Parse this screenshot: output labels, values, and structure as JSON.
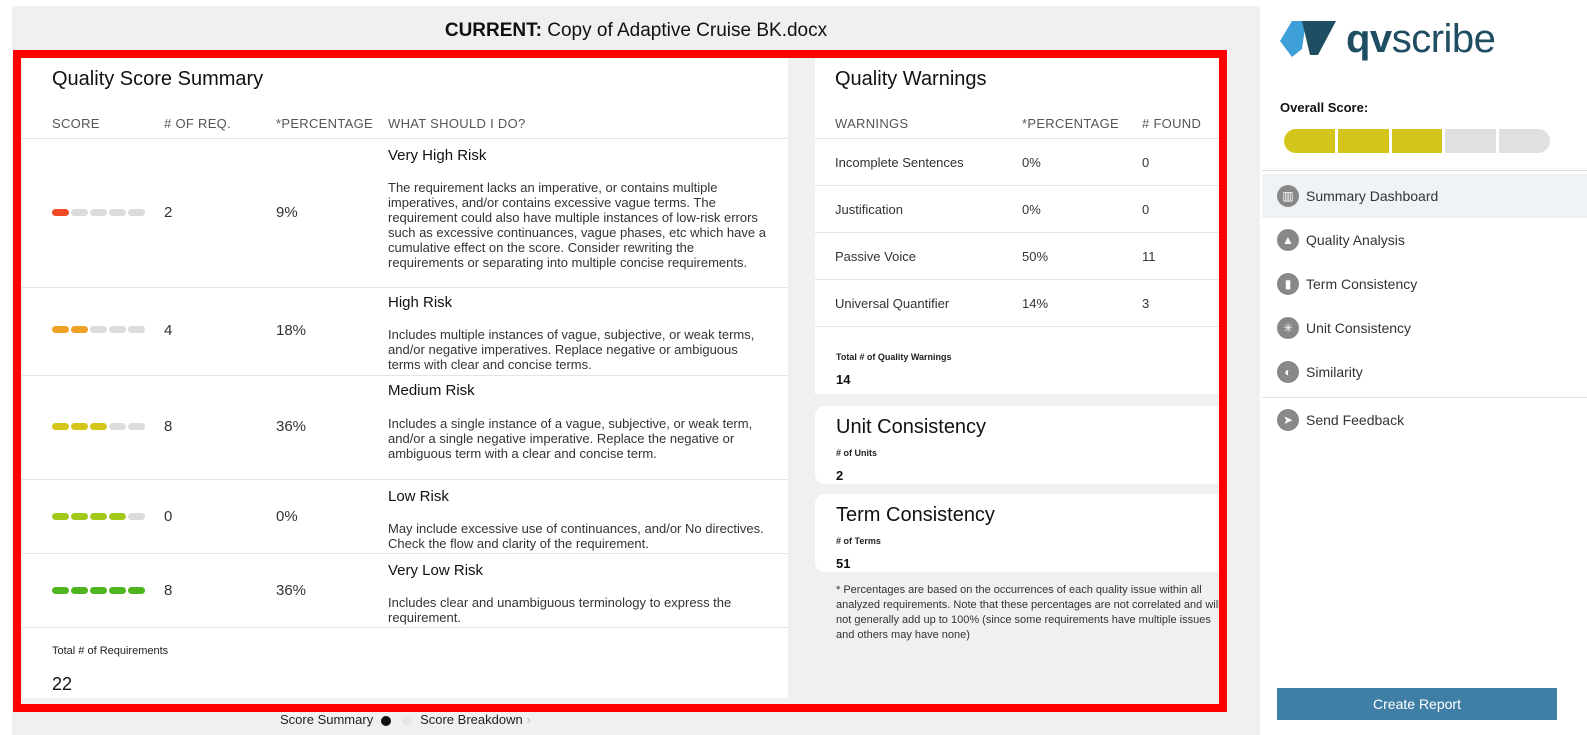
{
  "header": {
    "current_label": "CURRENT:",
    "document_name": "Copy of Adaptive Cruise BK.docx"
  },
  "summary": {
    "title": "Quality Score Summary",
    "columns": {
      "score": "SCORE",
      "num_req": "# OF REQ.",
      "percentage": "*PERCENTAGE",
      "what_to_do": "WHAT SHOULD I DO?"
    },
    "rows": [
      {
        "level": 1,
        "color": "#f04a24",
        "count": "2",
        "percentage": "9%",
        "title": "Very High Risk",
        "description": "The requirement lacks an imperative, or contains multiple imperatives, and/or contains excessive vague terms. The requirement could also have multiple instances of low-risk errors such as excessive continuances, vague phases, etc which have a cumulative effect on the score. Consider rewriting the requirements or separating into multiple concise requirements."
      },
      {
        "level": 2,
        "color": "#f0a025",
        "count": "4",
        "percentage": "18%",
        "title": "High Risk",
        "description": "Includes multiple instances of vague, subjective, or weak terms, and/or negative imperatives. Replace negative or ambiguous terms with clear and concise terms."
      },
      {
        "level": 3,
        "color": "#d4c51a",
        "count": "8",
        "percentage": "36%",
        "title": "Medium Risk",
        "description": "Includes a single instance of a vague, subjective, or weak term, and/or a single negative imperative. Replace the negative or ambiguous term with a clear and concise term."
      },
      {
        "level": 4,
        "color": "#a3c81c",
        "count": "0",
        "percentage": "0%",
        "title": "Low Risk",
        "description": "May include excessive use of continuances, and/or No directives. Check the flow and clarity of the requirement."
      },
      {
        "level": 5,
        "color": "#4fb51f",
        "count": "8",
        "percentage": "36%",
        "title": "Very Low Risk",
        "description": "Includes clear and unambiguous terminology to express the requirement."
      }
    ],
    "total_label": "Total # of Requirements",
    "total_value": "22"
  },
  "warnings": {
    "title": "Quality Warnings",
    "columns": {
      "warning": "WARNINGS",
      "percentage": "*PERCENTAGE",
      "found": "# FOUND"
    },
    "rows": [
      {
        "name": "Incomplete Sentences",
        "percentage": "0%",
        "found": "0"
      },
      {
        "name": "Justification",
        "percentage": "0%",
        "found": "0"
      },
      {
        "name": "Passive Voice",
        "percentage": "50%",
        "found": "11"
      },
      {
        "name": "Universal Quantifier",
        "percentage": "14%",
        "found": "3"
      }
    ],
    "total_label": "Total # of Quality Warnings",
    "total_value": "14"
  },
  "unit_consistency": {
    "title": "Unit Consistency",
    "label": "# of Units",
    "value": "2"
  },
  "term_consistency": {
    "title": "Term Consistency",
    "label": "# of Terms",
    "value": "51"
  },
  "footnote": "* Percentages are based on the occurrences of each quality issue within all analyzed requirements. Note that these percentages are not correlated and will not generally add up to 100% (since some requirements have multiple issues and others may have none)",
  "carousel": {
    "item1": "Score Summary",
    "item2": "Score Breakdown",
    "next": "›"
  },
  "sidebar": {
    "logo_bold": "qv",
    "logo_light": "scribe",
    "overall_label": "Overall Score:",
    "overall_score_segments_filled": 3,
    "overall_score_segments_total": 5,
    "score_color": "#d4c51a",
    "nav": [
      {
        "label": "Summary Dashboard",
        "icon": "dashboard-icon",
        "glyph": "▥",
        "active": true
      },
      {
        "label": "Quality Analysis",
        "icon": "warning-icon",
        "glyph": "▲",
        "active": false
      },
      {
        "label": "Term Consistency",
        "icon": "book-icon",
        "glyph": "▮",
        "active": false
      },
      {
        "label": "Unit Consistency",
        "icon": "units-icon",
        "glyph": "✳",
        "active": false
      },
      {
        "label": "Similarity",
        "icon": "similarity-icon",
        "glyph": "◐",
        "active": false
      }
    ],
    "feedback_label": "Send Feedback",
    "create_report": "Create Report"
  }
}
